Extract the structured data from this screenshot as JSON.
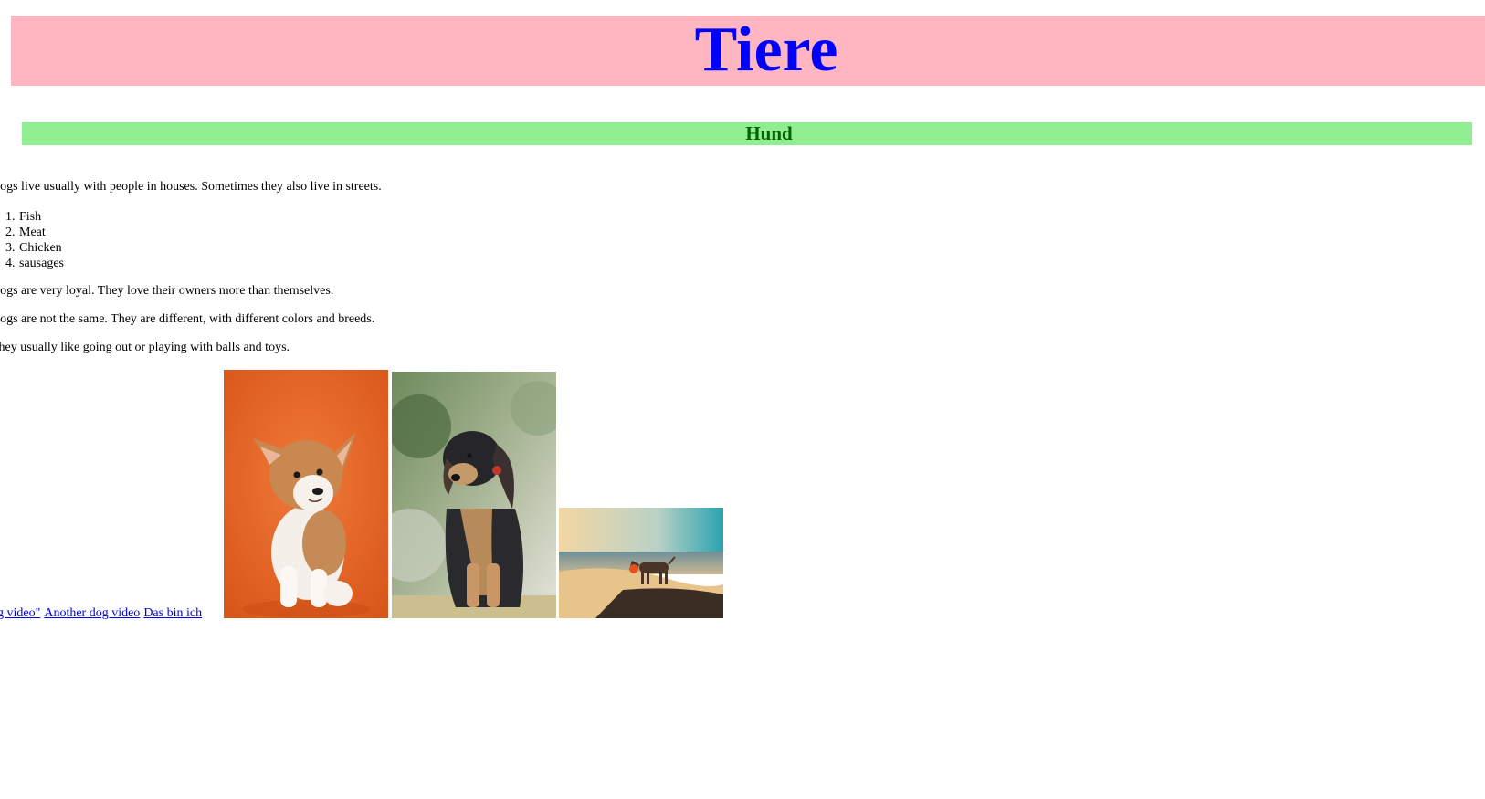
{
  "header": {
    "title": "Tiere",
    "title_color": "#0000ff",
    "background": "#ffb6c1"
  },
  "section": {
    "heading": "Hund",
    "heading_color": "#006400",
    "background": "#90ee90"
  },
  "content": {
    "intro": "Dogs live usually with people in houses. Sometimes they also live in streets.",
    "foods": [
      {
        "num": "1.",
        "label": "Fish"
      },
      {
        "num": "2.",
        "label": "Meat"
      },
      {
        "num": "3.",
        "label": "Chicken"
      },
      {
        "num": "4.",
        "label": "sausages"
      }
    ],
    "loyalty": "Dogs are very loyal. They love their owners more than themselves.",
    "variety": "Dogs are not the same. They are different, with different colors and breeds.",
    "play": "They usually like going out or playing with balls and toys."
  },
  "links": {
    "video1": "dog video\"",
    "video2": "Another dog video",
    "about": "Das bin ich"
  },
  "images": [
    {
      "name": "corgi-puppy-photo",
      "subject": "corgi puppy on orange background"
    },
    {
      "name": "sitting-dog-photo",
      "subject": "black and tan dog sitting outdoors"
    },
    {
      "name": "beach-dog-photo",
      "subject": "dog on beach at sunset with ball"
    }
  ]
}
